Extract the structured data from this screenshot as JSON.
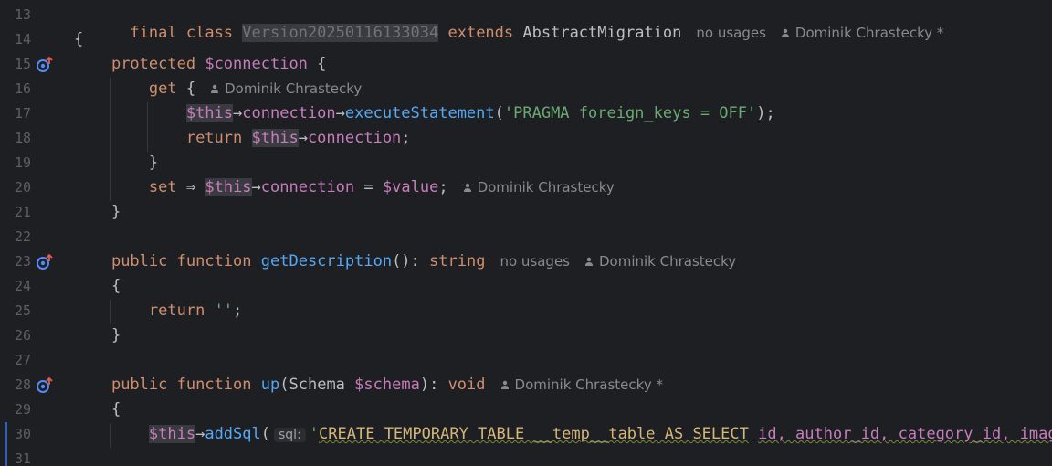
{
  "lines": {
    "l13": {
      "num": "13",
      "kw_final": "final",
      "kw_class": "class",
      "classname": "Version20250116133034",
      "kw_extends": "extends",
      "parent": "AbstractMigration",
      "hint_usages": "no usages",
      "hint_author": "Dominik Chrastecky *"
    },
    "l14": {
      "num": "14",
      "brace": "{"
    },
    "l15": {
      "num": "15",
      "kw_protected": "protected",
      "var": "$connection",
      "brace": "{"
    },
    "l16": {
      "num": "16",
      "kw_get": "get",
      "brace": "{",
      "hint_author": "Dominik Chrastecky"
    },
    "l17": {
      "num": "17",
      "this": "$this",
      "arrow1": "→",
      "prop": "connection",
      "arrow2": "→",
      "method": "executeStatement",
      "open": "(",
      "string": "'PRAGMA foreign_keys = OFF'",
      "close": ");"
    },
    "l18": {
      "num": "18",
      "kw_return": "return",
      "this": "$this",
      "arrow": "→",
      "prop": "connection",
      "end": ";"
    },
    "l19": {
      "num": "19",
      "brace": "}"
    },
    "l20": {
      "num": "20",
      "kw_set": "set",
      "fat_arrow": "⇒",
      "this": "$this",
      "arrow": "→",
      "prop": "connection",
      "eq": "=",
      "value": "$value",
      "end": ";",
      "hint_author": "Dominik Chrastecky"
    },
    "l21": {
      "num": "21",
      "brace": "}"
    },
    "l22": {
      "num": "22"
    },
    "l23": {
      "num": "23",
      "kw_public": "public",
      "kw_function": "function",
      "fname": "getDescription",
      "parens": "():",
      "rtype": "string",
      "hint_usages": "no usages",
      "hint_author": "Dominik Chrastecky"
    },
    "l24": {
      "num": "24",
      "brace": "{"
    },
    "l25": {
      "num": "25",
      "kw_return": "return",
      "string": "''",
      "end": ";"
    },
    "l26": {
      "num": "26",
      "brace": "}"
    },
    "l27": {
      "num": "27"
    },
    "l28": {
      "num": "28",
      "kw_public": "public",
      "kw_function": "function",
      "fname": "up",
      "open": "(",
      "ptype": "Schema",
      "pvar": "$schema",
      "close": "):",
      "rtype": "void",
      "hint_author": "Dominik Chrastecky *"
    },
    "l29": {
      "num": "29",
      "brace": "{"
    },
    "l30": {
      "num": "30",
      "this": "$this",
      "arrow": "→",
      "method": "addSql",
      "open": "(",
      "param_hint": "sql:",
      "quote": "'",
      "sql_text": "CREATE TEMPORARY TABLE __temp__table AS SELECT",
      "sql_ids": "id, author_id, category_id, image"
    },
    "l31": {
      "num": "31"
    }
  },
  "icons": {
    "override_marker": "implements-override-icon",
    "author": "user-icon"
  },
  "colors": {
    "background": "#1e1f22",
    "keyword": "#cf8e6d",
    "variable": "#c77dbb",
    "function": "#56a8f5",
    "string": "#6aab73",
    "hint": "#868a91",
    "modified": "#375fad"
  }
}
